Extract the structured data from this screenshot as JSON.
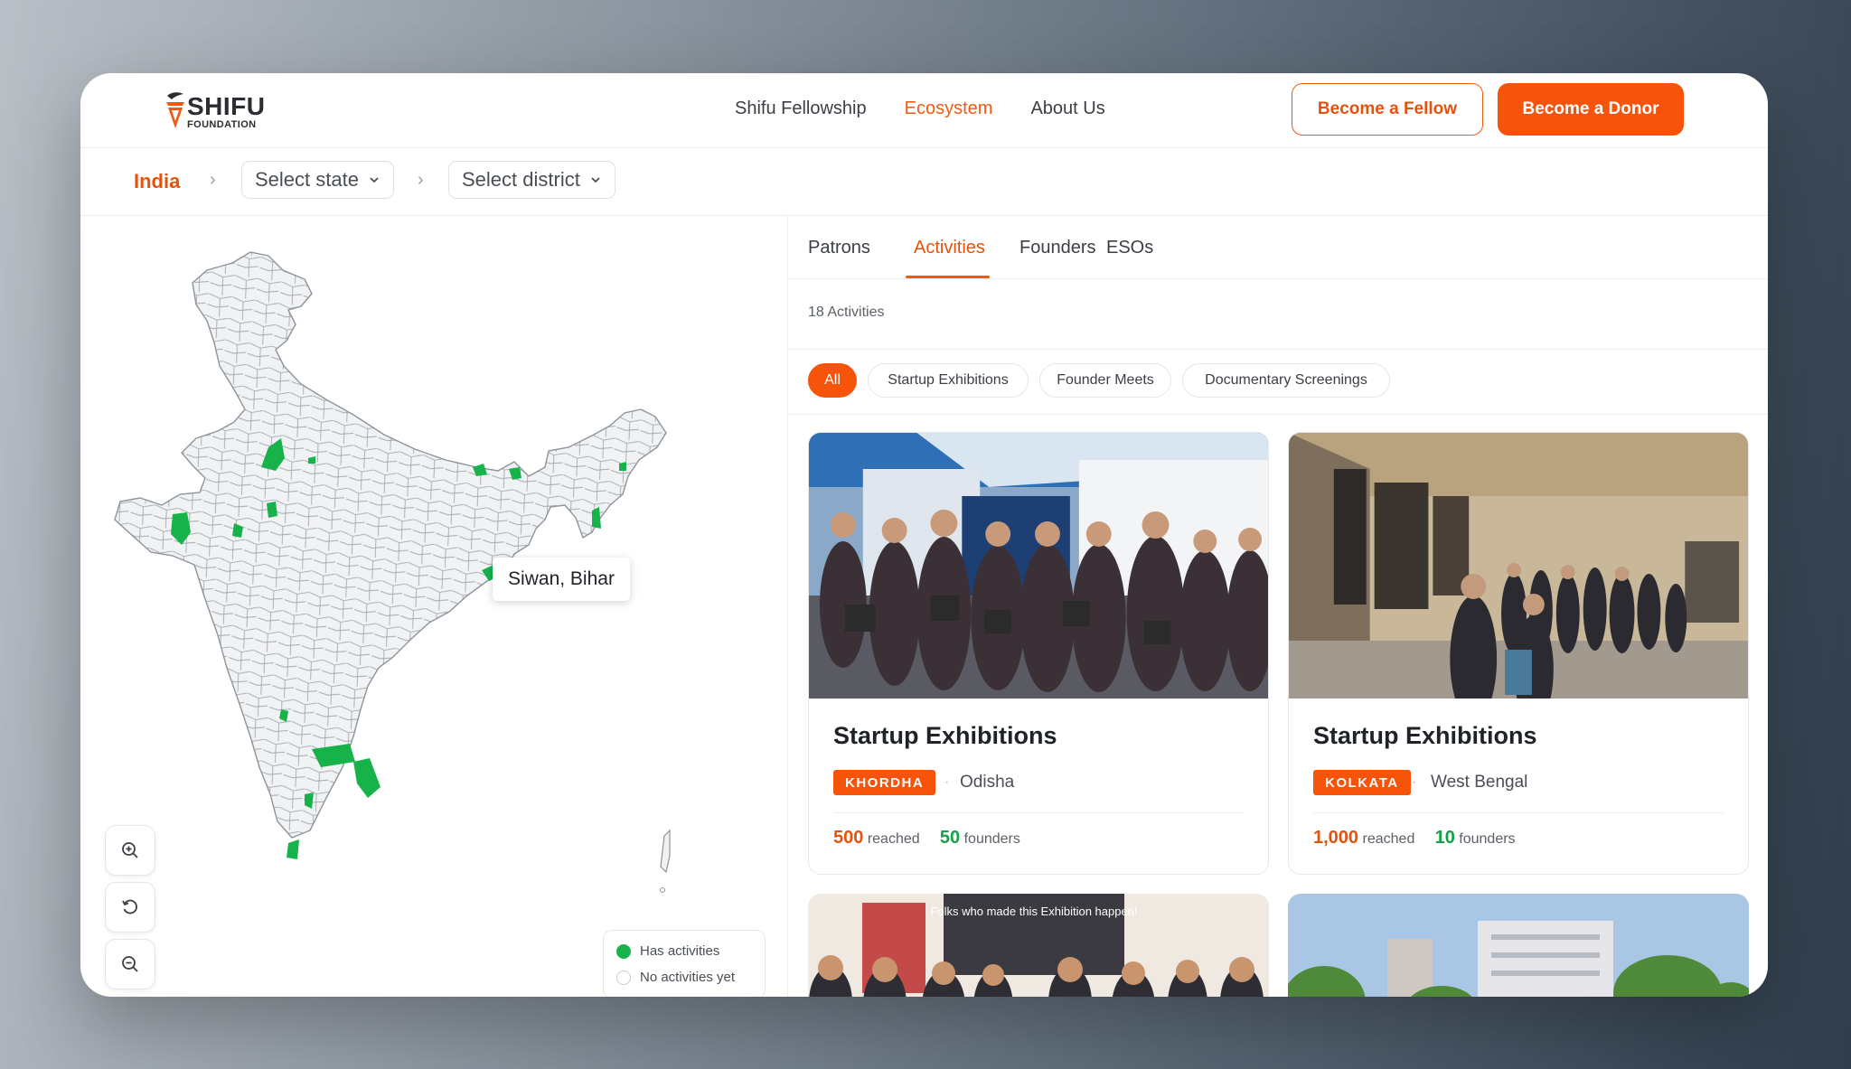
{
  "brand": {
    "name": "SHIFU",
    "sub": "FOUNDATION"
  },
  "nav": [
    {
      "label": "Shifu Fellowship"
    },
    {
      "label": "Ecosystem"
    },
    {
      "label": "About Us"
    }
  ],
  "header_actions": {
    "fellow": "Become a Fellow",
    "donor": "Become a Donor"
  },
  "breadcrumb": {
    "root": "India",
    "state_placeholder": "Select state",
    "district_placeholder": "Select district"
  },
  "map": {
    "tooltip": "Siwan, Bihar",
    "legend": {
      "active": "Has activities",
      "inactive": "No activities yet"
    },
    "colors": {
      "active": "#17b34a",
      "inactive": "#f1f2f4",
      "border": "#9ea4ab"
    }
  },
  "tabs": [
    {
      "label": "Patrons"
    },
    {
      "label": "Activities"
    },
    {
      "label": "Founders"
    },
    {
      "label": "ESOs"
    }
  ],
  "activities_count": "18 Activities",
  "filters": [
    {
      "label": "All"
    },
    {
      "label": "Startup Exhibitions"
    },
    {
      "label": "Founder Meets"
    },
    {
      "label": "Documentary Screenings"
    }
  ],
  "cards": [
    {
      "title": "Startup Exhibitions",
      "district": "KHORDHA",
      "state": "Odisha",
      "reached": "500",
      "reached_label": "reached",
      "founders": "50",
      "founders_label": "founders"
    },
    {
      "title": "Startup Exhibitions",
      "district": "KOLKATA",
      "state": "West Bengal",
      "reached": "1,000",
      "reached_label": "reached",
      "founders": "10",
      "founders_label": "founders"
    }
  ],
  "photo_text": {
    "sign": "Folks who made this Exhibition happen!"
  },
  "accent": "#f25a13"
}
